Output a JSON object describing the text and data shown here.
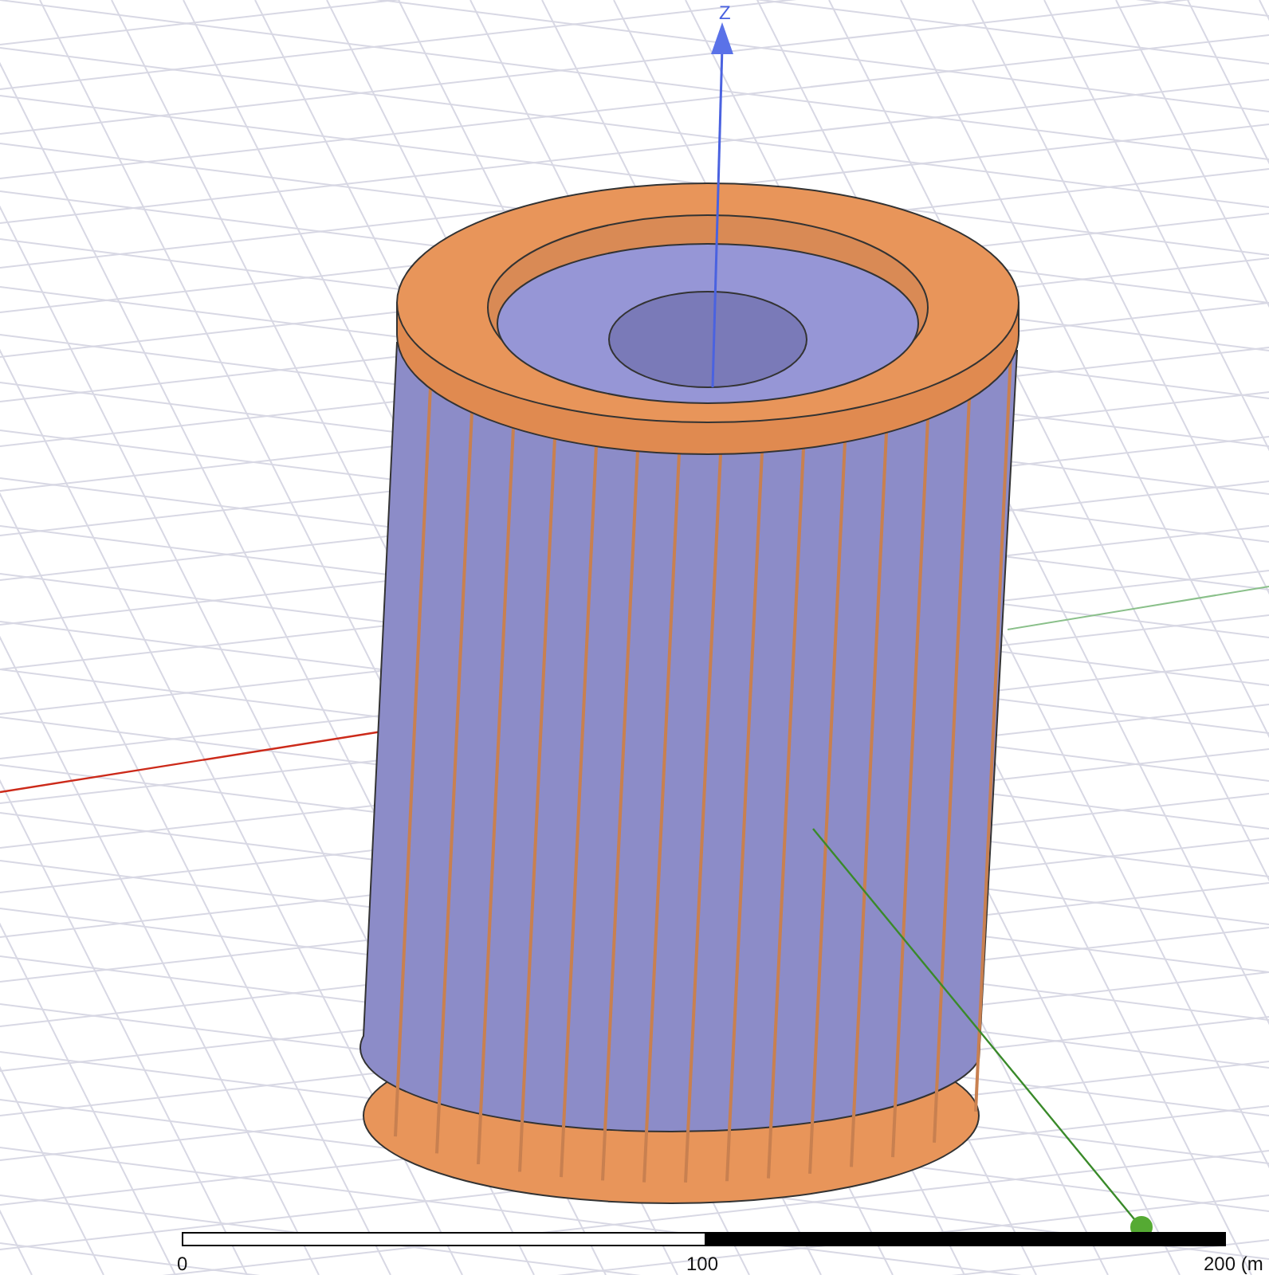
{
  "axes": {
    "z_label": "Z"
  },
  "scale_bar": {
    "ticks": [
      "0",
      "100",
      "200 (m"
    ]
  }
}
